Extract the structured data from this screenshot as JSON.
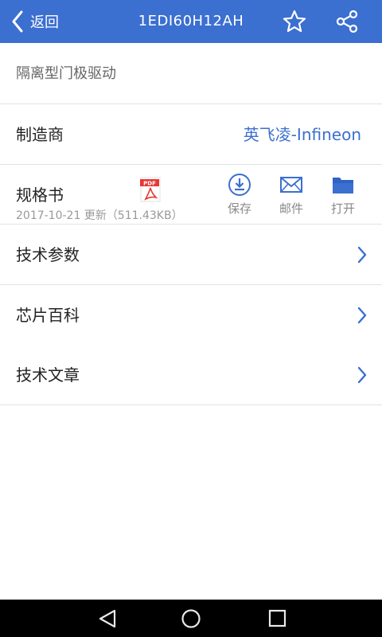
{
  "header": {
    "back_label": "返回",
    "title": "1EDI60H12AH"
  },
  "description": "隔离型门极驱动",
  "manufacturer": {
    "label": "制造商",
    "value": "英飞凌-Infineon"
  },
  "datasheet": {
    "label": "规格书",
    "updated": "2017-10-21 更新（511.43KB）",
    "file_type_icon": "pdf-icon",
    "actions": [
      {
        "label": "保存",
        "icon": "download-icon"
      },
      {
        "label": "邮件",
        "icon": "mail-icon"
      },
      {
        "label": "打开",
        "icon": "folder-icon"
      }
    ]
  },
  "menu": [
    {
      "label": "技术参数"
    },
    {
      "label": "芯片百科"
    },
    {
      "label": "技术文章"
    }
  ],
  "colors": {
    "accent": "#3b6fd0",
    "muted": "#8a8a8a"
  }
}
